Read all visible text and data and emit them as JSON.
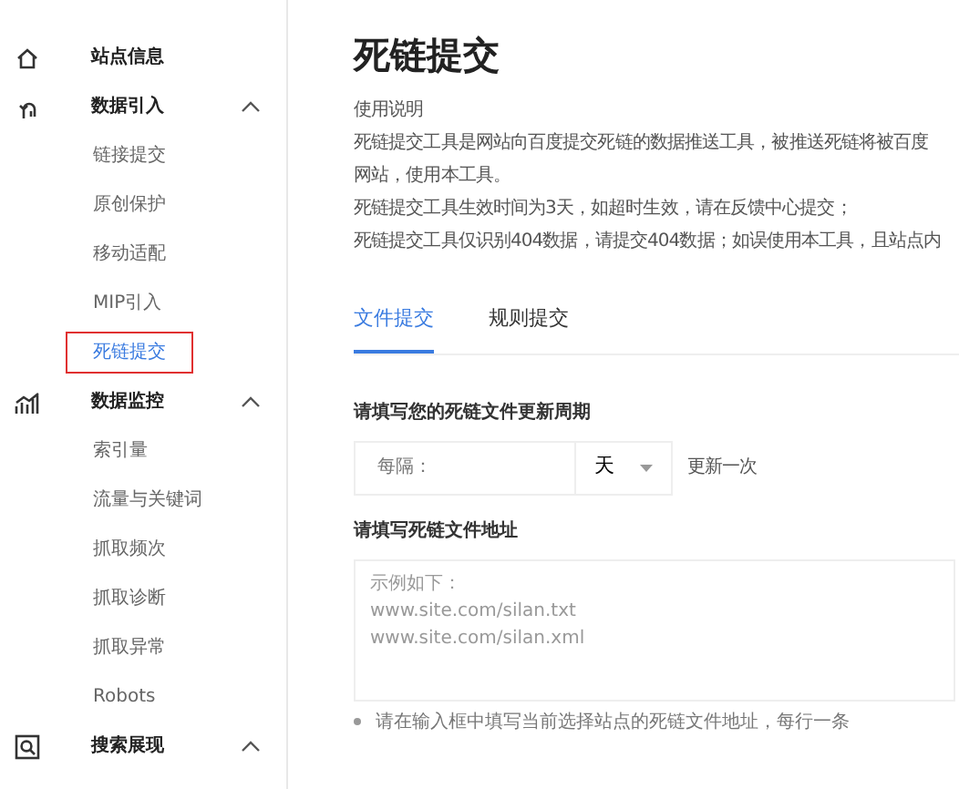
{
  "sidebar": {
    "items": [
      {
        "label": "站点信息"
      },
      {
        "label": "数据引入",
        "expanded": true,
        "children": [
          {
            "label": "链接提交",
            "selected": false
          },
          {
            "label": "原创保护",
            "selected": false
          },
          {
            "label": "移动适配",
            "selected": false
          },
          {
            "label": "MIP引入",
            "selected": false
          },
          {
            "label": "死链提交",
            "selected": true
          }
        ]
      },
      {
        "label": "数据监控",
        "expanded": true,
        "children": [
          {
            "label": "索引量",
            "selected": false
          },
          {
            "label": "流量与关键词",
            "selected": false
          },
          {
            "label": "抓取频次",
            "selected": false
          },
          {
            "label": "抓取诊断",
            "selected": false
          },
          {
            "label": "抓取异常",
            "selected": false
          },
          {
            "label": "Robots",
            "selected": false
          }
        ]
      },
      {
        "label": "搜索展现",
        "expanded": true
      }
    ]
  },
  "page": {
    "title": "死链提交",
    "usage_heading": "使用说明",
    "usage_lines": [
      "死链提交工具是网站向百度提交死链的数据推送工具，被推送死链将被百度",
      "网站，使用本工具。",
      "死链提交工具生效时间为3天，如超时生效，请在反馈中心提交；",
      "死链提交工具仅识别404数据，请提交404数据；如误使用本工具，且站点内"
    ],
    "tabs": [
      {
        "label": "文件提交",
        "selected": true
      },
      {
        "label": "规则提交",
        "selected": false
      }
    ],
    "period": {
      "label": "请填写您的死链文件更新周期",
      "placeholder": "每隔：",
      "unit": "天",
      "suffix": "更新一次"
    },
    "address": {
      "label": "请填写死链文件地址",
      "placeholder": "示例如下：\nwww.site.com/silan.txt\nwww.site.com/silan.xml"
    },
    "hint": "请在输入框中填写当前选择站点的死链文件地址，每行一条"
  }
}
